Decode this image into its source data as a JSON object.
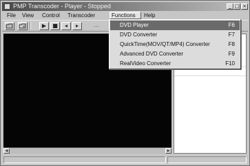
{
  "window": {
    "title": "PMP Transcoder - Player - Stopped",
    "controls": {
      "minimize": "_",
      "maximize": "□",
      "close": "×"
    }
  },
  "menubar": {
    "items": [
      "File",
      "View",
      "Control",
      "Transcoder",
      "Functions",
      "Help"
    ],
    "open_menu": "Functions"
  },
  "toolbar": {
    "icons": [
      "open-folder-icon",
      "open-disc-icon",
      "play-icon",
      "stop-icon",
      "previous-icon",
      "next-icon",
      "more-icon"
    ],
    "glyphs": {
      "play": "▶",
      "stop": "■",
      "prev": "◂",
      "next": "▸",
      "more": "…"
    }
  },
  "functions_menu": {
    "items": [
      {
        "label": "DVD Player",
        "shortcut": "F6",
        "selected": true
      },
      {
        "label": "DVD Converter",
        "shortcut": "F7",
        "selected": false
      },
      {
        "label": "QuickTime(MOV/QT/MP4) Converter",
        "shortcut": "F8",
        "selected": false
      },
      {
        "label": "Advanced DVD Converter",
        "shortcut": "F9",
        "selected": false
      },
      {
        "label": "RealVideo Converter",
        "shortcut": "F10",
        "selected": false
      }
    ]
  },
  "scrollbar": {
    "left_arrow": "◀",
    "right_arrow": "▶"
  },
  "colors": {
    "menu_highlight": "#6a6a6a",
    "video_background": "#050505",
    "titlebar_start": "#4a4a4a"
  }
}
